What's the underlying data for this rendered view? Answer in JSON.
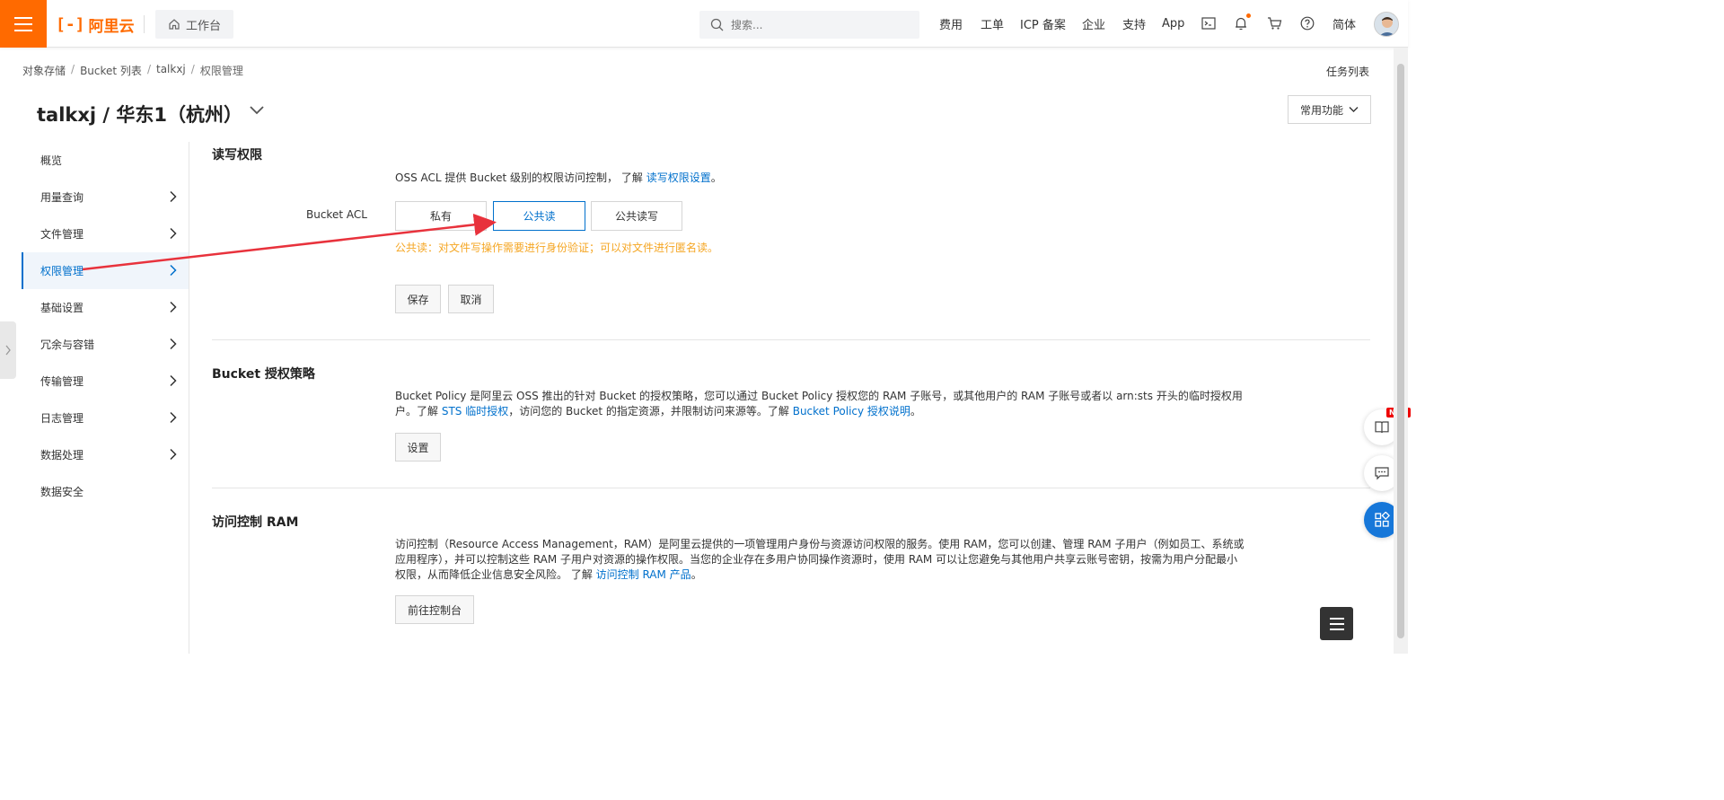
{
  "header": {
    "logo_mark": "[-]",
    "logo_text": "阿里云",
    "workbench_label": "工作台",
    "search_placeholder": "搜索...",
    "nav_links": [
      "费用",
      "工单",
      "ICP 备案",
      "企业",
      "支持",
      "App"
    ],
    "lang_label": "简体"
  },
  "breadcrumb": {
    "items": [
      "对象存储",
      "Bucket 列表",
      "talkxj",
      "权限管理"
    ],
    "separator": "/"
  },
  "task_list_label": "任务列表",
  "page_title": "talkxj / 华东1（杭州）",
  "common_functions_label": "常用功能",
  "sidebar": {
    "items": [
      {
        "label": "概览",
        "has_chevron": false
      },
      {
        "label": "用量查询",
        "has_chevron": true
      },
      {
        "label": "文件管理",
        "has_chevron": true
      },
      {
        "label": "权限管理",
        "has_chevron": true,
        "active": true
      },
      {
        "label": "基础设置",
        "has_chevron": true
      },
      {
        "label": "冗余与容错",
        "has_chevron": true
      },
      {
        "label": "传输管理",
        "has_chevron": true
      },
      {
        "label": "日志管理",
        "has_chevron": true
      },
      {
        "label": "数据处理",
        "has_chevron": true
      },
      {
        "label": "数据安全",
        "has_chevron": false
      }
    ]
  },
  "acl_section": {
    "title": "读写权限",
    "desc_prefix": "OSS ACL 提供 Bucket 级别的权限访问控制， 了解 ",
    "desc_link": "读写权限设置",
    "desc_suffix": "。",
    "label": "Bucket ACL",
    "options": [
      "私有",
      "公共读",
      "公共读写"
    ],
    "selected_option": "公共读",
    "hint": "公共读：对文件写操作需要进行身份验证；可以对文件进行匿名读。",
    "save_label": "保存",
    "cancel_label": "取消"
  },
  "policy_section": {
    "title": "Bucket 授权策略",
    "desc_line1": "Bucket Policy 是阿里云 OSS 推出的针对 Bucket 的授权策略，您可以通过 Bucket Policy 授权您的 RAM 子账号，或其他用户的 RAM 子账号或者以 arn:sts 开头的临时授权用",
    "desc_line2_prefix": "户。了解 ",
    "desc_link1": "STS 临时授权",
    "desc_mid": "，访问您的 Bucket 的指定资源，并限制访问来源等。了解 ",
    "desc_link2": "Bucket Policy 授权说明",
    "desc_suffix": "。",
    "button_label": "设置"
  },
  "ram_section": {
    "title": "访问控制 RAM",
    "desc_line1": "访问控制（Resource Access Management，RAM）是阿里云提供的一项管理用户身份与资源访问权限的服务。使用 RAM，您可以创建、管理 RAM 子用户（例如员工、系统或",
    "desc_line2": "应用程序），并可以控制这些 RAM 子用户对资源的操作权限。当您的企业存在多用户协同操作资源时，使用 RAM 可以让您避免与其他用户共享云账号密钥，按需为用户分配最小",
    "desc_line3_prefix": "权限，从而降低企业信息安全风险。 了解 ",
    "desc_link": "访问控制 RAM 产品",
    "desc_suffix": "。",
    "button_label": "前往控制台"
  },
  "floating": {
    "new_badge": "NEW"
  },
  "colors": {
    "brand": "#ff6a00",
    "link": "#0070cc",
    "hint": "#f5a623",
    "annotation_arrow": "#e8323c"
  }
}
